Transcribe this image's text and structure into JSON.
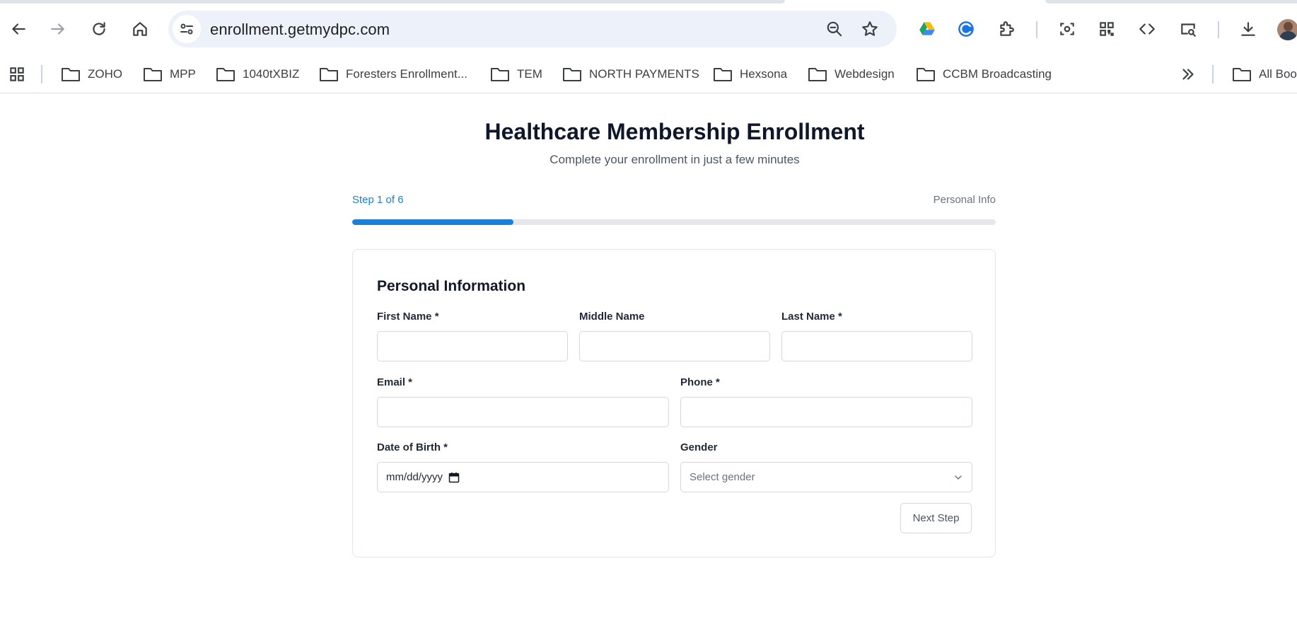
{
  "browser": {
    "url": "enrollment.getmydpc.com",
    "bookmarks": [
      "ZOHO",
      "MPP",
      "1040tXBIZ",
      "Foresters Enrollment...",
      "TEM",
      "NORTH PAYMENTS",
      "Hexsona",
      "Webdesign",
      "CCBM Broadcasting"
    ],
    "all_bookmarks_label": "All Boo",
    "icons": [
      "back-arrow-icon",
      "forward-arrow-icon",
      "reload-icon",
      "home-icon",
      "site-info-icon",
      "zoom-icon",
      "star-icon",
      "google-drive-icon",
      "copilot-icon",
      "extensions-icon",
      "screenshot-icon",
      "qr-code-icon",
      "code-icon",
      "search-page-icon",
      "download-icon",
      "profile-avatar",
      "apps-grid-icon",
      "chevron-double-right-icon",
      "folder-icon"
    ]
  },
  "page": {
    "title": "Healthcare Membership Enrollment",
    "subtitle": "Complete your enrollment in just a few minutes"
  },
  "progress": {
    "step_label": "Step 1 of 6",
    "step_name": "Personal Info",
    "fraction": 0.25,
    "color": "#1a7fd6"
  },
  "form": {
    "title": "Personal Information",
    "first_name": {
      "label": "First Name *",
      "value": ""
    },
    "middle_name": {
      "label": "Middle Name",
      "value": ""
    },
    "last_name": {
      "label": "Last Name *",
      "value": ""
    },
    "email": {
      "label": "Email *",
      "value": ""
    },
    "phone": {
      "label": "Phone *",
      "value": ""
    },
    "dob": {
      "label": "Date of Birth *",
      "placeholder": "mm/dd/yyyy"
    },
    "gender": {
      "label": "Gender",
      "placeholder": "Select gender"
    },
    "next_label": "Next Step"
  }
}
